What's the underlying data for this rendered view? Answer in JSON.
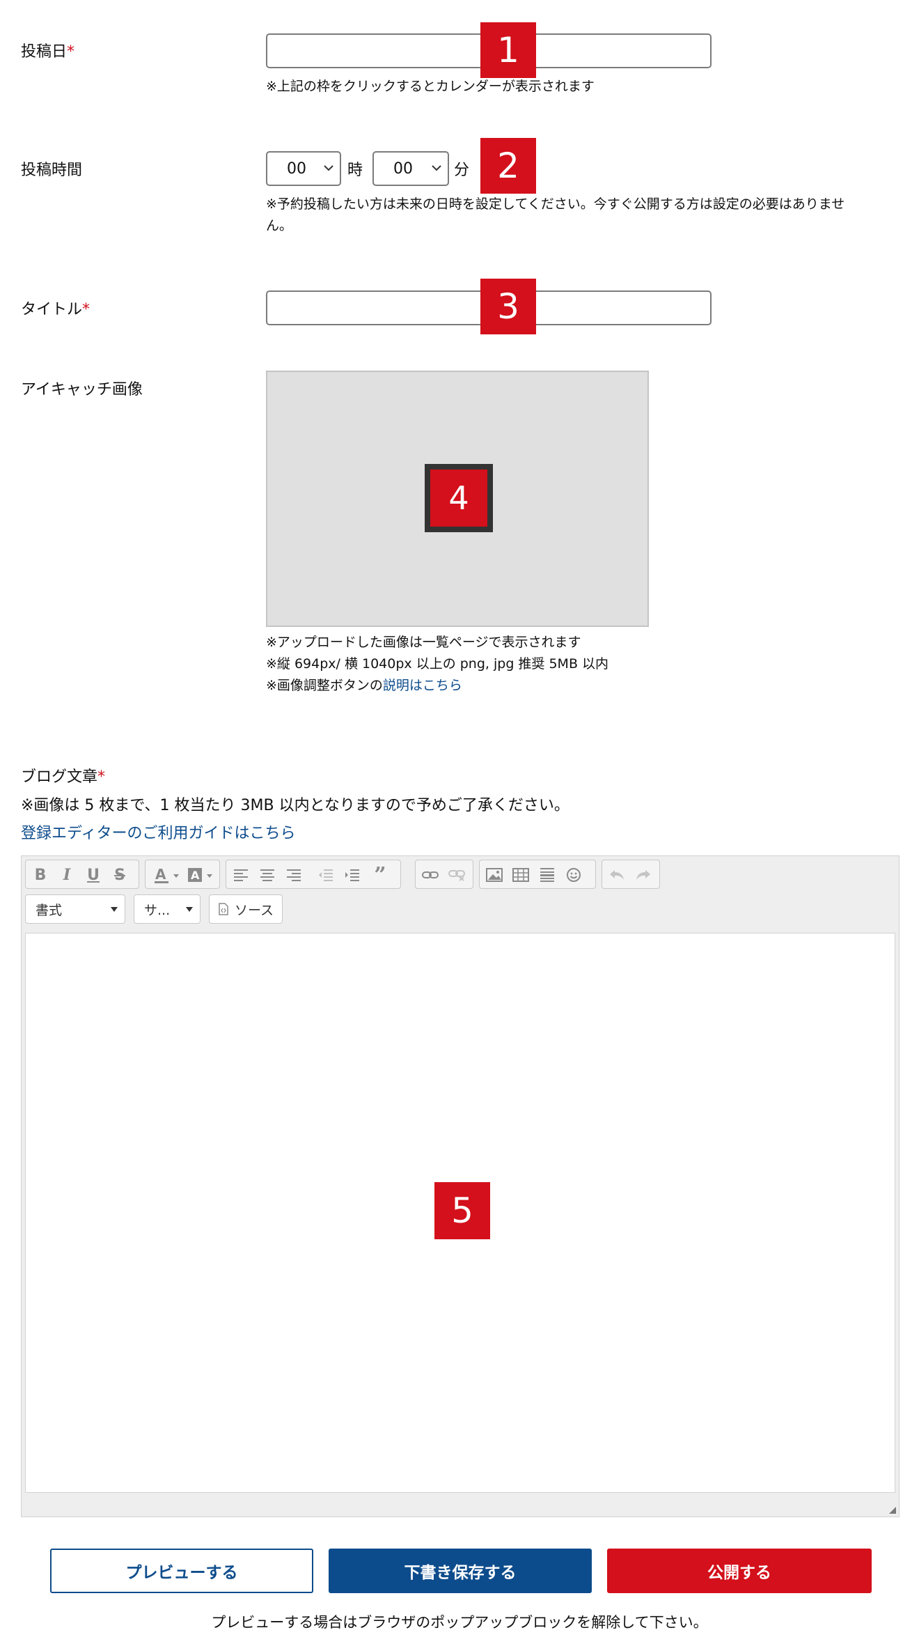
{
  "fields": {
    "post_date": {
      "label": "投稿日",
      "required_mark": "*",
      "value": "",
      "note": "※上記の枠をクリックするとカレンダーが表示されます",
      "badge": "1"
    },
    "post_time": {
      "label": "投稿時間",
      "hour_value": "00",
      "hour_unit": "時",
      "minute_value": "00",
      "minute_unit": "分",
      "note_line1": "※予約投稿したい方は未来の日時を設定してください。今すぐ公開する方は設定の必要はありませ",
      "note_line2": "ん。",
      "badge": "2"
    },
    "title": {
      "label": "タイトル",
      "required_mark": "*",
      "value": "",
      "badge": "3"
    },
    "eyecatch": {
      "label": "アイキャッチ画像",
      "badge": "4",
      "note1": "※アップロードした画像は一覧ページで表示されます",
      "note2": "※縦 694px/ 横 1040px 以上の png, jpg 推奨 5MB 以内",
      "note3_prefix": "※画像調整ボタンの",
      "note3_link": "説明はこちら"
    }
  },
  "body_section": {
    "label": "ブログ文章",
    "required_mark": "*",
    "note": "※画像は 5 枚まで、1 枚当たり 3MB 以内となりますので予めご了承ください。",
    "guide_link": "登録エディターのご利用ガイドはこちら",
    "badge": "5"
  },
  "editor": {
    "format_combo": "書式",
    "size_combo": "サ...",
    "source_label": "ソース",
    "toolbar_icons": [
      "bold-icon",
      "italic-icon",
      "underline-icon",
      "strike-icon",
      "text-color-icon",
      "bg-color-icon",
      "align-left-icon",
      "align-center-icon",
      "align-right-icon",
      "outdent-icon",
      "indent-icon",
      "blockquote-icon",
      "link-icon",
      "unlink-icon",
      "image-icon",
      "table-icon",
      "hr-icon",
      "emoji-icon",
      "undo-icon",
      "redo-icon"
    ],
    "content": ""
  },
  "actions": {
    "preview": "プレビューする",
    "save_draft": "下書き保存する",
    "publish": "公開する",
    "popup_note": "プレビューする場合はブラウザのポップアップブロックを解除して下さい。"
  },
  "colors": {
    "accent_red": "#d3101b",
    "primary_blue": "#0d4c8c",
    "link_blue": "#0d4c8c"
  }
}
